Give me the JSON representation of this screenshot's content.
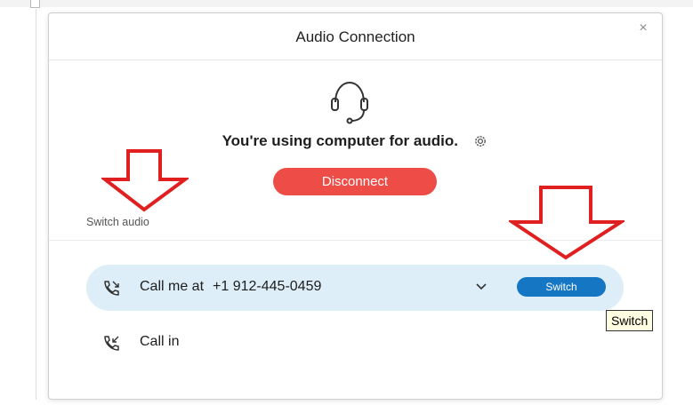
{
  "dialog": {
    "title": "Audio Connection",
    "close_glyph": "×",
    "status_text": "You're using computer for audio.",
    "disconnect_label": "Disconnect",
    "switch_audio_label": "Switch audio",
    "call_me": {
      "label": "Call me at",
      "number": "+1 912-445-0459",
      "switch_label": "Switch"
    },
    "call_in": {
      "label": "Call in"
    }
  },
  "tooltip": {
    "text": "Switch"
  },
  "icons": {
    "headset": "headset-icon",
    "gear": "gear-icon",
    "phone_outgoing": "phone-outgoing-icon",
    "phone_incoming": "phone-incoming-icon",
    "chevron": "chevron-down-icon",
    "close": "close-icon"
  },
  "colors": {
    "disconnect": "#ee4d47",
    "switch_button": "#1576c4",
    "callme_row_bg": "#ddeef8",
    "annotation_arrow": "#e02020",
    "tooltip_bg": "#fffde1"
  }
}
